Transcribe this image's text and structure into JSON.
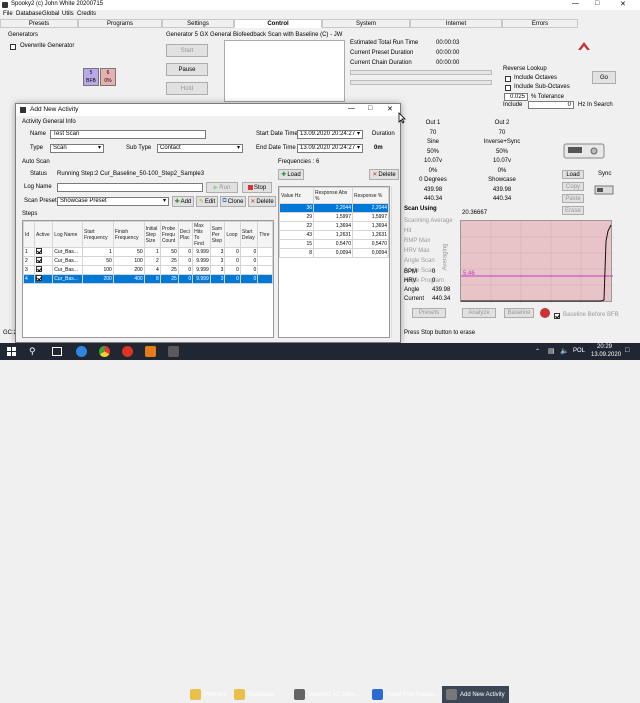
{
  "main_window": {
    "title": "Spooky2 (c) John White 20200715",
    "menu": [
      "File",
      "Database",
      "Global",
      "Utils",
      "Credits"
    ],
    "tabs": [
      "Presets",
      "Programs",
      "Settings",
      "Control",
      "System",
      "Internet",
      "Errors"
    ],
    "active_tab": "Control",
    "generators_label": "Generators",
    "overwrite_generator": "Overwrite Generator",
    "gen_badge_left": {
      "line1": "5",
      "line2": "BFB"
    },
    "gen_badge_right": {
      "line1": "6",
      "line2": "0%"
    },
    "generator_header": "Generator 5    GX General Biofeedback Scan with Baseline (C) - JW",
    "buttons": {
      "start": "Start",
      "pause": "Pause",
      "hold": "Hold"
    },
    "run_info": [
      {
        "label": "Estimated Total Run Time",
        "value": "00:00:03"
      },
      {
        "label": "Current Preset Duration",
        "value": "00:00:00"
      },
      {
        "label": "Current Chain Duration",
        "value": "00:00:00"
      }
    ],
    "reverse_lookup": {
      "title": "Reverse Lookup",
      "include_octaves": "Include Octaves",
      "include_suboctaves": "Include Sub-Octaves",
      "tolerance_value": "0.025",
      "tolerance_label": "% Tolerance",
      "include_label": "Include",
      "include_value": "0",
      "hz_in_search": "Hz In Search",
      "go": "Go"
    },
    "out1": {
      "title": "Out 1",
      "values": [
        "70",
        "Sine",
        "50%",
        "10.07v",
        "0%",
        "0 Degrees",
        "439.98",
        "440.34"
      ]
    },
    "out2": {
      "title": "Out 2",
      "values": [
        "70",
        "Inverse+Sync",
        "50%",
        "10.07v",
        "0%",
        "Showcase",
        "439.98",
        "440.34"
      ]
    },
    "side_buttons": [
      "Load",
      "Copy",
      "Paste",
      "Erase"
    ],
    "sync_label": "Sync",
    "graph": {
      "title_value": "20.36667",
      "marker_value": "5.46",
      "ylabel": "Averaging"
    },
    "scan_using": "Scan Using",
    "scan_using_items": [
      "Scanning Average",
      "Hit",
      "RMP Max",
      "HRV Max",
      "Angle Scan",
      "Angle Scan",
      "Angle Program"
    ],
    "readouts": [
      {
        "label": "BPM",
        "value": "0"
      },
      {
        "label": "HRV",
        "value": "0"
      },
      {
        "label": "Angle",
        "value": "439.98"
      },
      {
        "label": "Current",
        "value": "440.34"
      }
    ],
    "bottom_buttons": {
      "presets": "Presets",
      "analyze": "Analyze",
      "baseline": "Baseline"
    },
    "baseline_before": "Baseline Before BFB",
    "status_left": "GC:2",
    "status_right": "Press Stop button to erase"
  },
  "dialog": {
    "title": "Add New Activity",
    "general_info": "Activity General Info",
    "name_label": "Name",
    "name_value": "Test Scan",
    "type_label": "Type",
    "type_value": "Scan",
    "subtype_label": "Sub Type",
    "subtype_value": "Contact",
    "start_label": "Start Date Time",
    "start_value": "13.09.2020 20:24:27",
    "end_label": "End Date Time",
    "end_value": "13.09.2020 20:24:27",
    "duration_label": "Duration",
    "duration_value": "0m",
    "auto_scan": "Auto Scan",
    "status_label": "Status",
    "status_value": "Running Step:2 Cur_Baseline_50-100_Step2_Sample3",
    "log_name_label": "Log Name",
    "run_btn": "Run",
    "stop_btn": "Stop",
    "scan_preset_label": "Scan Preset",
    "scan_preset_value": "Showcase Preset",
    "add_btn": "Add",
    "edit_btn": "Edit",
    "clone_btn": "Clone",
    "delete_btn": "Delete",
    "steps_label": "Steps",
    "steps_headers": [
      "Id",
      "Active",
      "Log Name",
      "Start Frequency",
      "Finish Frequency",
      "Initial Step Size",
      "Probe Frequ Count",
      "Deci Plac",
      "Max Hits To Find",
      "Sam Per Step",
      "Loop",
      "Start Delay",
      "Thre"
    ],
    "steps_rows": [
      [
        "1",
        "",
        "Cur_Bas...",
        "1",
        "50",
        "1",
        "50",
        "0",
        "9.999",
        "3",
        "0",
        "0",
        ""
      ],
      [
        "2",
        "",
        "Cur_Bas...",
        "50",
        "100",
        "2",
        "25",
        "0",
        "9.999",
        "3",
        "0",
        "0",
        ""
      ],
      [
        "3",
        "",
        "Cur_Bas...",
        "100",
        "200",
        "4",
        "25",
        "0",
        "9.999",
        "3",
        "0",
        "0",
        ""
      ],
      [
        "4",
        "",
        "Cur_Bas...",
        "200",
        "400",
        "8",
        "25",
        "0",
        "9.999",
        "3",
        "0",
        "0",
        ""
      ]
    ],
    "frequencies_label": "Frequencies : 6",
    "freq_load": "Load",
    "freq_delete": "Delete",
    "freq_headers": [
      "Value Hz",
      "Response Abs %",
      "Response %"
    ],
    "freq_rows": [
      [
        "36",
        "2,2044",
        "2,2044"
      ],
      [
        "29",
        "1,5997",
        "1,5997"
      ],
      [
        "22",
        "1,3694",
        "1,3694"
      ],
      [
        "43",
        "1,2631",
        "1,2631"
      ],
      [
        "15",
        "0,5470",
        "0,5470"
      ],
      [
        "8",
        "0,0094",
        "0,0094"
      ]
    ]
  },
  "taskbar": {
    "items": [
      "Pobrane",
      "ScanData",
      "Spooky2 (c) John...",
      "Royal Rife Freque...",
      "Add New Activity"
    ],
    "lang": "POL",
    "time": "20:29",
    "date": "13.09.2020"
  }
}
